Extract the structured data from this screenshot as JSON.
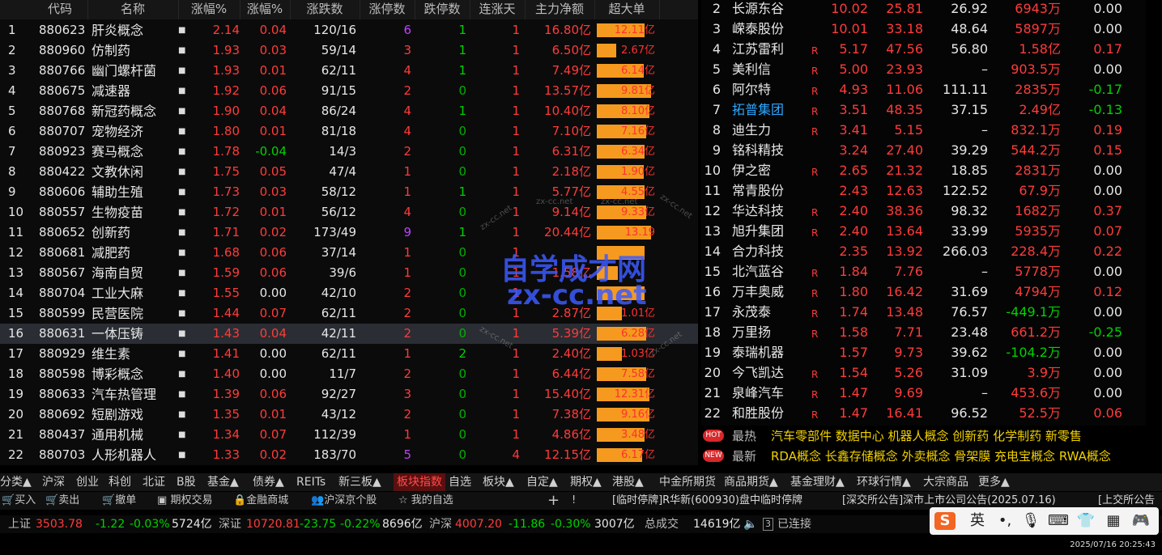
{
  "left_header": [
    "代码",
    "名称",
    "涨幅%",
    "涨幅%",
    "涨跌数",
    "涨停数",
    "跌停数",
    "连涨天",
    "主力净额",
    "超大单"
  ],
  "board_rows": [
    {
      "idx": "1",
      "code": "880623",
      "name": "肝炎概念",
      "chg": "2.14",
      "spd": "0.04",
      "ud": "120/16",
      "up": "6",
      "dn": "1",
      "cons": "1",
      "flow": "16.80亿",
      "big": "12.11亿",
      "big_pct": 0.8
    },
    {
      "idx": "2",
      "code": "880960",
      "name": "仿制药",
      "chg": "1.93",
      "spd": "0.03",
      "ud": "59/14",
      "up": "3",
      "dn": "1",
      "cons": "1",
      "flow": "6.50亿",
      "big": "2.67亿",
      "big_pct": 0.32
    },
    {
      "idx": "3",
      "code": "880766",
      "name": "幽门螺杆菌",
      "chg": "1.93",
      "spd": "0.01",
      "ud": "62/11",
      "up": "4",
      "dn": "1",
      "cons": "1",
      "flow": "7.49亿",
      "big": "6.14亿",
      "big_pct": 0.78
    },
    {
      "idx": "4",
      "code": "880675",
      "name": "减速器",
      "chg": "1.92",
      "spd": "0.06",
      "ud": "91/15",
      "up": "2",
      "dn": "0",
      "cons": "1",
      "flow": "13.57亿",
      "big": "9.81亿",
      "big_pct": 0.9
    },
    {
      "idx": "5",
      "code": "880768",
      "name": "新冠药概念",
      "chg": "1.90",
      "spd": "0.04",
      "ud": "86/24",
      "up": "4",
      "dn": "1",
      "cons": "1",
      "flow": "10.40亿",
      "big": "8.10亿",
      "big_pct": 0.88
    },
    {
      "idx": "6",
      "code": "880707",
      "name": "宠物经济",
      "chg": "1.80",
      "spd": "0.01",
      "ud": "81/18",
      "up": "4",
      "dn": "0",
      "cons": "1",
      "flow": "7.10亿",
      "big": "7.16亿",
      "big_pct": 0.82
    },
    {
      "idx": "7",
      "code": "880923",
      "name": "赛马概念",
      "chg": "1.78",
      "spd": "-0.04",
      "ud": "14/3",
      "up": "2",
      "dn": "0",
      "cons": "1",
      "flow": "6.31亿",
      "big": "6.34亿",
      "big_pct": 0.8
    },
    {
      "idx": "8",
      "code": "880422",
      "name": "文教休闲",
      "chg": "1.75",
      "spd": "0.05",
      "ud": "47/4",
      "up": "1",
      "dn": "0",
      "cons": "1",
      "flow": "2.18亿",
      "big": "1.90亿",
      "big_pct": 0.78
    },
    {
      "idx": "9",
      "code": "880606",
      "name": "辅助生殖",
      "chg": "1.73",
      "spd": "0.03",
      "ud": "58/12",
      "up": "1",
      "dn": "1",
      "cons": "1",
      "flow": "5.77亿",
      "big": "4.55亿",
      "big_pct": 0.8
    },
    {
      "idx": "10",
      "code": "880557",
      "name": "生物疫苗",
      "chg": "1.72",
      "spd": "0.01",
      "ud": "56/12",
      "up": "4",
      "dn": "0",
      "cons": "1",
      "flow": "9.14亿",
      "big": "9.33亿",
      "big_pct": 0.82
    },
    {
      "idx": "11",
      "code": "880652",
      "name": "创新药",
      "chg": "1.71",
      "spd": "0.02",
      "ud": "173/49",
      "up": "9",
      "dn": "1",
      "cons": "1",
      "flow": "20.44亿",
      "big": "13.19",
      "big_pct": 0.9
    },
    {
      "idx": "12",
      "code": "880681",
      "name": "减肥药",
      "chg": "1.68",
      "spd": "0.06",
      "ud": "37/14",
      "up": "1",
      "dn": "0",
      "cons": "1",
      "flow": "",
      "big": "",
      "big_pct": 0.8
    },
    {
      "idx": "13",
      "code": "880567",
      "name": "海南自贸",
      "chg": "1.59",
      "spd": "0.06",
      "ud": "39/6",
      "up": "1",
      "dn": "0",
      "cons": "1",
      "flow": "1.58亿",
      "big": "",
      "big_pct": 0.35
    },
    {
      "idx": "14",
      "code": "880704",
      "name": "工业大麻",
      "chg": "1.55",
      "spd": "0.00",
      "ud": "42/10",
      "up": "2",
      "dn": "0",
      "cons": "1",
      "flow": "",
      "big": "",
      "big_pct": 0.8
    },
    {
      "idx": "15",
      "code": "880599",
      "name": "民营医院",
      "chg": "1.44",
      "spd": "0.07",
      "ud": "62/11",
      "up": "2",
      "dn": "0",
      "cons": "1",
      "flow": "2.87亿",
      "big": "1.01亿",
      "big_pct": 0.42
    },
    {
      "idx": "16",
      "code": "880631",
      "name": "一体压铸",
      "chg": "1.43",
      "spd": "0.04",
      "ud": "42/11",
      "up": "2",
      "dn": "0",
      "cons": "1",
      "flow": "5.39亿",
      "big": "6.28亿",
      "big_pct": 0.82
    },
    {
      "idx": "17",
      "code": "880929",
      "name": "维生素",
      "chg": "1.41",
      "spd": "0.00",
      "ud": "62/11",
      "up": "1",
      "dn": "2",
      "cons": "1",
      "flow": "2.40亿",
      "big": "1.03亿",
      "big_pct": 0.42
    },
    {
      "idx": "18",
      "code": "880598",
      "name": "博彩概念",
      "chg": "1.40",
      "spd": "0.00",
      "ud": "11/7",
      "up": "2",
      "dn": "0",
      "cons": "1",
      "flow": "6.44亿",
      "big": "7.58亿",
      "big_pct": 0.82
    },
    {
      "idx": "19",
      "code": "880633",
      "name": "汽车热管理",
      "chg": "1.39",
      "spd": "0.06",
      "ud": "92/27",
      "up": "3",
      "dn": "0",
      "cons": "1",
      "flow": "15.40亿",
      "big": "12.31亿",
      "big_pct": 0.88
    },
    {
      "idx": "20",
      "code": "880692",
      "name": "短剧游戏",
      "chg": "1.35",
      "spd": "0.01",
      "ud": "43/12",
      "up": "2",
      "dn": "0",
      "cons": "1",
      "flow": "7.38亿",
      "big": "9.16亿",
      "big_pct": 0.88
    },
    {
      "idx": "21",
      "code": "880437",
      "name": "通用机械",
      "chg": "1.34",
      "spd": "0.07",
      "ud": "112/39",
      "up": "1",
      "dn": "0",
      "cons": "1",
      "flow": "4.86亿",
      "big": "3.48亿",
      "big_pct": 0.8
    },
    {
      "idx": "22",
      "code": "880703",
      "name": "人形机器人",
      "chg": "1.33",
      "spd": "0.02",
      "ud": "183/70",
      "up": "5",
      "dn": "0",
      "cons": "4",
      "flow": "12.15亿",
      "big": "6.17亿",
      "big_pct": 0.75
    }
  ],
  "stock_rows": [
    {
      "idx": "2",
      "name": "长源东谷",
      "mark": "",
      "chg": "10.02",
      "vol": "25.81",
      "pe": "26.92",
      "flow": "6943万",
      "spd": "0.00"
    },
    {
      "idx": "3",
      "name": "嵘泰股份",
      "mark": "",
      "chg": "10.01",
      "vol": "33.18",
      "pe": "48.64",
      "flow": "5897万",
      "spd": "0.00"
    },
    {
      "idx": "4",
      "name": "江苏雷利",
      "mark": "R",
      "chg": "5.17",
      "vol": "47.56",
      "pe": "56.80",
      "flow": "1.58亿",
      "spd": "0.17"
    },
    {
      "idx": "5",
      "name": "美利信",
      "mark": "R",
      "chg": "5.00",
      "vol": "23.93",
      "pe": "–",
      "flow": "903.5万",
      "spd": "0.00"
    },
    {
      "idx": "6",
      "name": "阿尔特",
      "mark": "R",
      "chg": "4.93",
      "vol": "11.06",
      "pe": "111.11",
      "flow": "2835万",
      "spd": "-0.17"
    },
    {
      "idx": "7",
      "name": "拓普集团",
      "mark": "R",
      "chg": "3.51",
      "vol": "48.35",
      "pe": "37.15",
      "flow": "2.49亿",
      "spd": "-0.13",
      "hl": true
    },
    {
      "idx": "8",
      "name": "迪生力",
      "mark": "R",
      "chg": "3.41",
      "vol": "5.15",
      "pe": "–",
      "flow": "832.1万",
      "spd": "0.19"
    },
    {
      "idx": "9",
      "name": "铭科精技",
      "mark": "",
      "chg": "3.24",
      "vol": "27.40",
      "pe": "39.29",
      "flow": "544.2万",
      "spd": "0.15"
    },
    {
      "idx": "10",
      "name": "伊之密",
      "mark": "R",
      "chg": "2.65",
      "vol": "21.32",
      "pe": "18.85",
      "flow": "2831万",
      "spd": "0.00"
    },
    {
      "idx": "11",
      "name": "常青股份",
      "mark": "",
      "chg": "2.43",
      "vol": "12.63",
      "pe": "122.52",
      "flow": "67.9万",
      "spd": "0.00"
    },
    {
      "idx": "12",
      "name": "华达科技",
      "mark": "R",
      "chg": "2.40",
      "vol": "38.36",
      "pe": "98.32",
      "flow": "1682万",
      "spd": "0.37"
    },
    {
      "idx": "13",
      "name": "旭升集团",
      "mark": "R",
      "chg": "2.40",
      "vol": "13.64",
      "pe": "33.99",
      "flow": "5935万",
      "spd": "0.07"
    },
    {
      "idx": "14",
      "name": "合力科技",
      "mark": "",
      "chg": "2.35",
      "vol": "13.92",
      "pe": "266.03",
      "flow": "228.4万",
      "spd": "0.22"
    },
    {
      "idx": "15",
      "name": "北汽蓝谷",
      "mark": "R",
      "chg": "1.84",
      "vol": "7.76",
      "pe": "–",
      "flow": "5778万",
      "spd": "0.00"
    },
    {
      "idx": "16",
      "name": "万丰奥威",
      "mark": "R",
      "chg": "1.80",
      "vol": "16.42",
      "pe": "31.69",
      "flow": "4794万",
      "spd": "0.12"
    },
    {
      "idx": "17",
      "name": "永茂泰",
      "mark": "R",
      "chg": "1.74",
      "vol": "13.48",
      "pe": "76.57",
      "flow": "-449.1万",
      "spd": "0.00"
    },
    {
      "idx": "18",
      "name": "万里扬",
      "mark": "R",
      "chg": "1.58",
      "vol": "7.71",
      "pe": "23.48",
      "flow": "661.2万",
      "spd": "-0.25"
    },
    {
      "idx": "19",
      "name": "泰瑞机器",
      "mark": "",
      "chg": "1.57",
      "vol": "9.73",
      "pe": "39.62",
      "flow": "-104.2万",
      "spd": "0.00"
    },
    {
      "idx": "20",
      "name": "今飞凯达",
      "mark": "R",
      "chg": "1.54",
      "vol": "5.26",
      "pe": "31.09",
      "flow": "3.9万",
      "spd": "0.00"
    },
    {
      "idx": "21",
      "name": "泉峰汽车",
      "mark": "R",
      "chg": "1.47",
      "vol": "9.69",
      "pe": "–",
      "flow": "453.6万",
      "spd": "0.00"
    },
    {
      "idx": "22",
      "name": "和胜股份",
      "mark": "R",
      "chg": "1.47",
      "vol": "16.41",
      "pe": "96.52",
      "flow": "52.5万",
      "spd": "0.06"
    }
  ],
  "hot": {
    "badge": "HOT",
    "label": "最热",
    "items": "汽车零部件  数据中心  机器人概念  创新药  化学制药  新零售"
  },
  "new": {
    "badge": "NEW",
    "label": "最新",
    "items": "RDA概念  长鑫存储概念  外卖概念  骨架膜  充电宝概念  RWA概念"
  },
  "tabs": [
    "分类▲",
    "沪深",
    "创业",
    "科创",
    "北证",
    "B股",
    "基金▲",
    "债券▲",
    "REITs",
    "新三板▲",
    "板块指数",
    "自选",
    "板块▲",
    "自定▲",
    "期权▲",
    "港股▲",
    "中金所期货",
    "商品期货▲",
    "基金理财▲",
    "环球行情▲",
    "大宗商品",
    "更多▲"
  ],
  "toolbar": [
    "买入",
    "卖出",
    "撤单",
    "期权交易",
    "金融商城",
    "沪深京个股",
    "我的自选"
  ],
  "toolbar_plus": "+",
  "toolbar_bang": "!",
  "news1": "[临时停牌]R华新(600930)盘中临时停牌",
  "news2": "[深交所公告]深市上市公司公告(2025.07.16)",
  "news3": "[上交所公告",
  "index": {
    "sh_label": "上证",
    "sh_val": "3503.78",
    "sh_chg": "-1.22",
    "sh_pct": "-0.03%",
    "sh_amt": "5724亿",
    "sz_label": "深证",
    "sz_val": "10720.81",
    "sz_chg": "-23.75",
    "sz_pct": "-0.22%",
    "sz_amt": "8696亿",
    "hs_label": "沪深",
    "hs_val": "4007.20",
    "hs_chg": "-11.86",
    "hs_pct": "-0.30%",
    "hs_amt": "3007亿",
    "total_label": "总成交",
    "total_amt": "14619亿",
    "conn": "已连接",
    "conn_num": "3"
  },
  "ime": {
    "logo": "S",
    "lang": "英"
  },
  "clock": "2025/07/16 20:25:43",
  "watermark": {
    "line1": "自学成才网",
    "line2": "zx-cc.net",
    "small": "zx-cc.net"
  },
  "colors": {
    "up": "#ff3b3b",
    "down": "#00d200",
    "bar": "#f59a1e",
    "highlight": "#2aa8ff",
    "hot": "#f0d000"
  }
}
